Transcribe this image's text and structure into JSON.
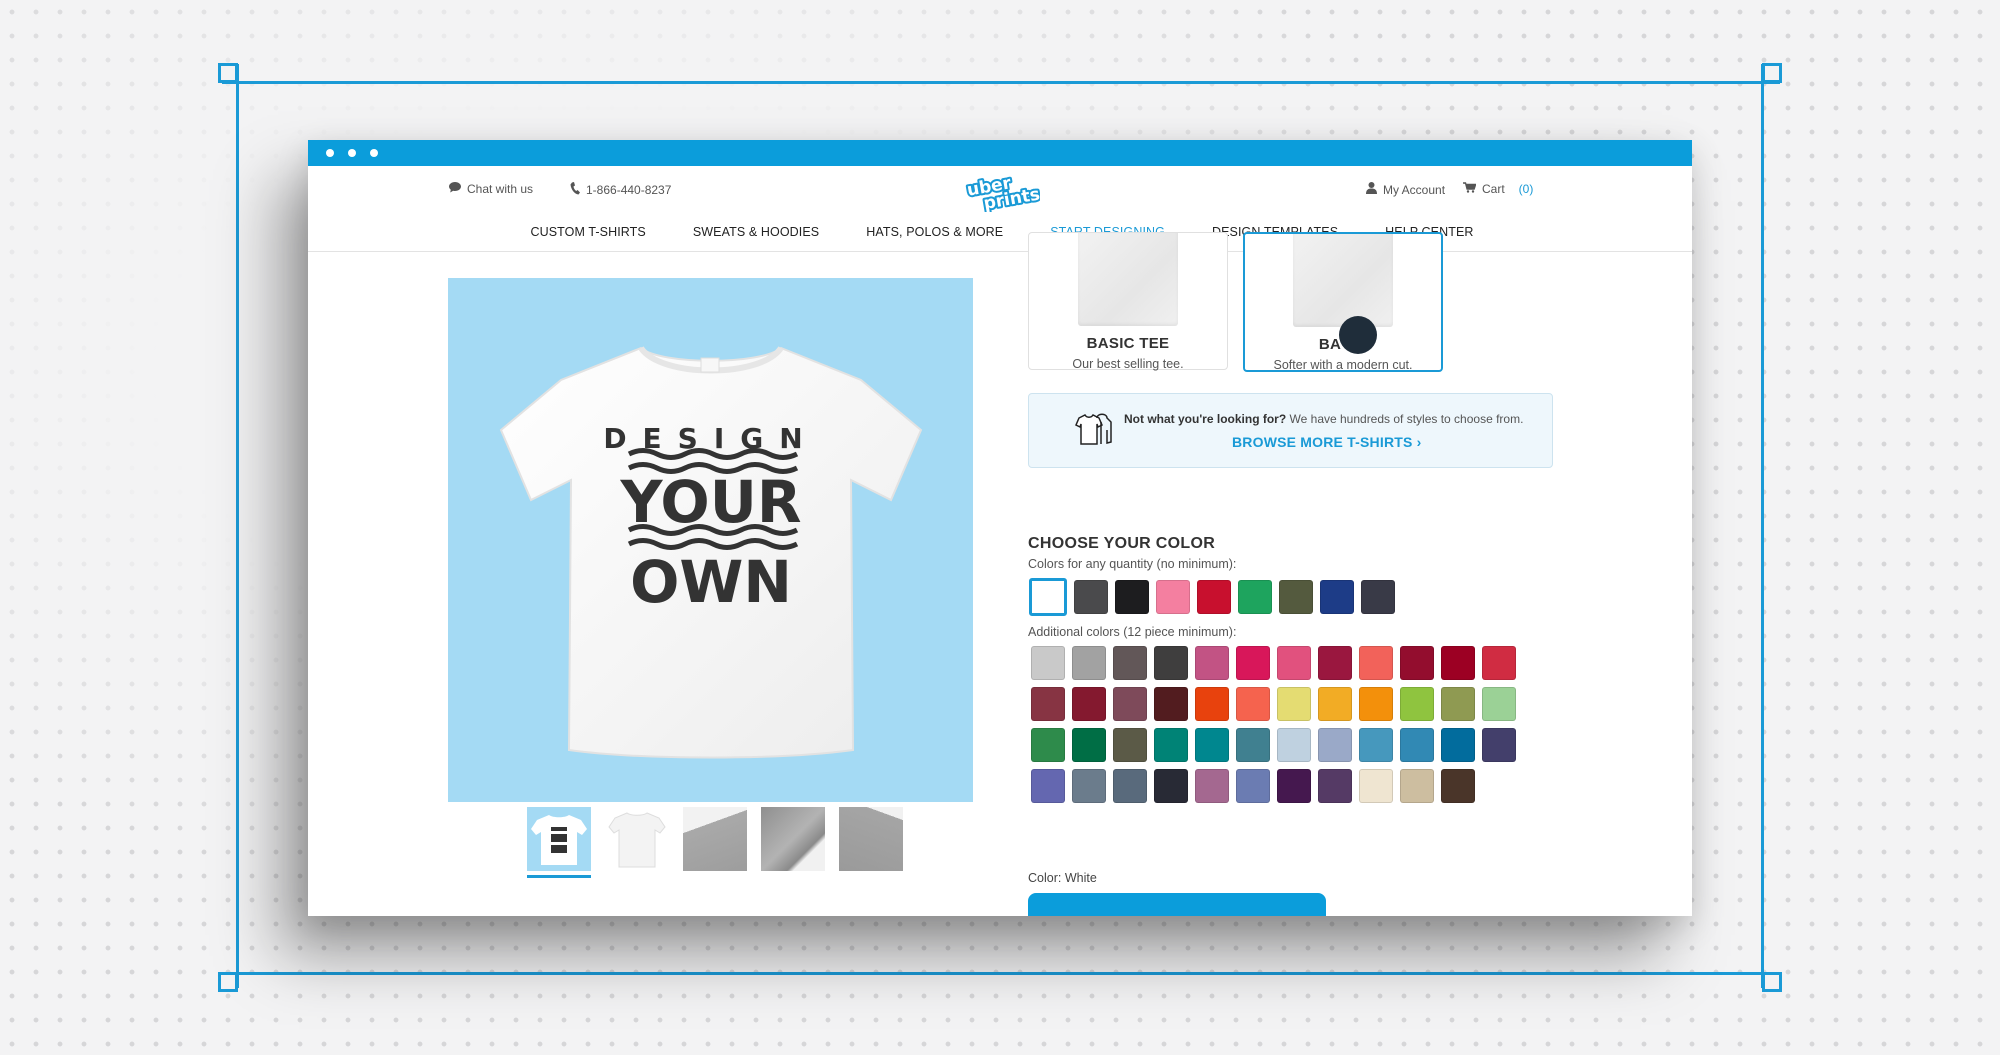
{
  "browser": {
    "window_dots": 3,
    "accent_color": "#0b9ddb"
  },
  "header": {
    "chat_label": "Chat with us",
    "chat_icon": "speech-bubble-icon",
    "phone": "1-866-440-8237",
    "phone_icon": "phone-icon",
    "logo_line1": "uber",
    "logo_line2": "prints",
    "account_label": "My Account",
    "account_icon": "user-icon",
    "cart_label": "Cart",
    "cart_count": "(0)",
    "cart_icon": "cart-icon"
  },
  "nav": {
    "items": [
      {
        "label": "CUSTOM T-SHIRTS",
        "active": false
      },
      {
        "label": "SWEATS & HOODIES",
        "active": false
      },
      {
        "label": "HATS, POLOS & MORE",
        "active": false
      },
      {
        "label": "START DESIGNING",
        "active": true
      },
      {
        "label": "DESIGN TEMPLATES",
        "active": false
      },
      {
        "label": "HELP CENTER",
        "active": false
      }
    ]
  },
  "product": {
    "image_background": "#a4daf4",
    "design_text": [
      "DESIGN",
      "YOUR",
      "OWN"
    ],
    "thumbnails": [
      {
        "name": "front-design",
        "active": true
      },
      {
        "name": "plain-front",
        "active": false
      },
      {
        "name": "collar-detail",
        "active": false
      },
      {
        "name": "hem-detail",
        "active": false
      },
      {
        "name": "sleeve-detail",
        "active": false
      }
    ]
  },
  "styles": [
    {
      "name": "BASIC TEE",
      "desc": "Our best selling tee.",
      "selected": false
    },
    {
      "name": "BA",
      "desc": "Softer with a modern cut.",
      "selected": true
    }
  ],
  "browse": {
    "question": "Not what you're looking for?",
    "message": " We have hundreds of styles to choose from.",
    "link": "BROWSE MORE T-SHIRTS ›"
  },
  "colors": {
    "title": "CHOOSE YOUR COLOR",
    "any_qty_label": "Colors for any quantity (no minimum):",
    "any_qty": [
      "#ffffff",
      "#4a4a4c",
      "#1d1d1f",
      "#f47fa0",
      "#c8102e",
      "#1ea45e",
      "#545a3e",
      "#1d3c87",
      "#393a47"
    ],
    "selected_index": 0,
    "additional_label": "Additional colors (12 piece minimum):",
    "additional": [
      "#c9c9c9",
      "#a2a2a2",
      "#625758",
      "#3f3e3e",
      "#c25384",
      "#d8175a",
      "#e1517e",
      "#9a173f",
      "#f2625a",
      "#930d2e",
      "#9c0023",
      "#d02c42",
      "#873443",
      "#84192f",
      "#7e4a5a",
      "#521c1f",
      "#e8420d",
      "#f5634e",
      "#e4dc72",
      "#f2ac25",
      "#f3900b",
      "#8fc43f",
      "#8f9a52",
      "#9bd196",
      "#2e8b4b",
      "#006e45",
      "#5b5a47",
      "#008376",
      "#00878f",
      "#408090",
      "#bfd1e0",
      "#9aa9c8",
      "#4698bd",
      "#3189b4",
      "#026c9d",
      "#433f6b",
      "#6467b0",
      "#6b7c8c",
      "#596a7c",
      "#282a35",
      "#a46890",
      "#6b7cb2",
      "#45184f",
      "#553a65",
      "#efe5d1",
      "#cdbea0",
      "#4a3529"
    ],
    "current_label": "Color: White"
  }
}
